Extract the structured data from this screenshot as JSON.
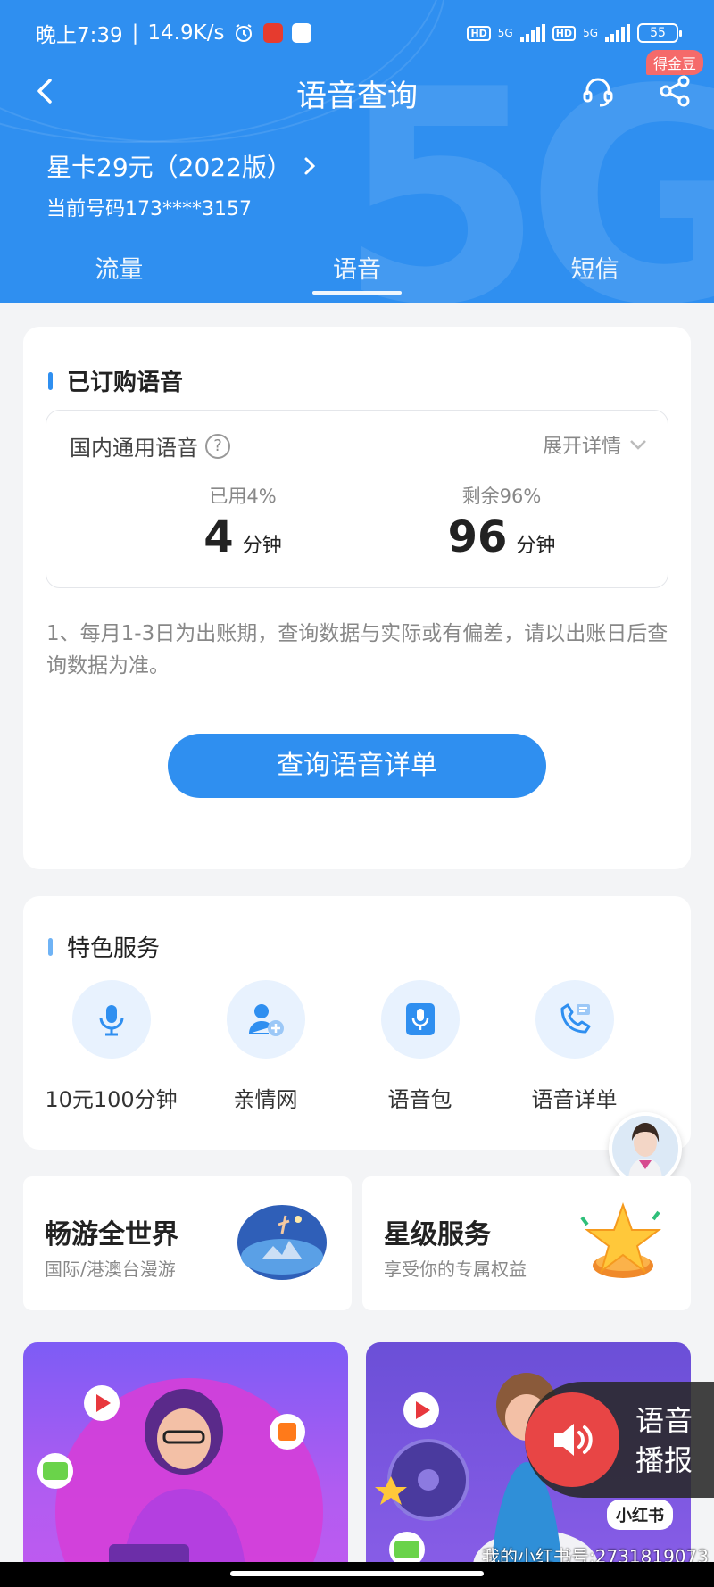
{
  "status_bar": {
    "time": "晚上7:39",
    "speed": "14.9K/s",
    "hd1": "HD",
    "net1": "5G",
    "hd2": "HD",
    "net2": "5G",
    "battery": "55"
  },
  "nav": {
    "title": "语音查询",
    "badge": "得金豆"
  },
  "plan": {
    "name": "星卡29元（2022版）",
    "phone": "当前号码173****3157"
  },
  "tabs": [
    {
      "label": "流量"
    },
    {
      "label": "语音"
    },
    {
      "label": "短信"
    }
  ],
  "subscribed": {
    "title": "已订购语音",
    "item_label": "国内通用语音",
    "help": "?",
    "expand": "展开详情",
    "used_pct": "已用4%",
    "used_value": "4",
    "used_unit": "分钟",
    "remain_pct": "剩余96%",
    "remain_value": "96",
    "remain_unit": "分钟",
    "note": "1、每月1-3日为出账期，查询数据与实际或有偏差，请以出账日后查询数据为准。",
    "button": "查询语音详单"
  },
  "services": {
    "title": "特色服务",
    "items": [
      {
        "label": "10元100分钟",
        "icon": "microphone-icon"
      },
      {
        "label": "亲情网",
        "icon": "add-user-icon"
      },
      {
        "label": "语音包",
        "icon": "voice-pack-icon"
      },
      {
        "label": "语音详单",
        "icon": "phone-list-icon"
      }
    ]
  },
  "promos": [
    {
      "title": "畅游全世界",
      "subtitle": "国际/港澳台漫游"
    },
    {
      "title": "星级服务",
      "subtitle": "享受你的专属权益"
    }
  ],
  "voice_widget": {
    "line1": "语音",
    "line2": "播报"
  },
  "overlay": {
    "xhs": "小红书",
    "watermark": "我的小红书号:2731819073"
  },
  "colors": {
    "brand_blue": "#2f8ff0",
    "badge_red": "#f56a6a"
  }
}
